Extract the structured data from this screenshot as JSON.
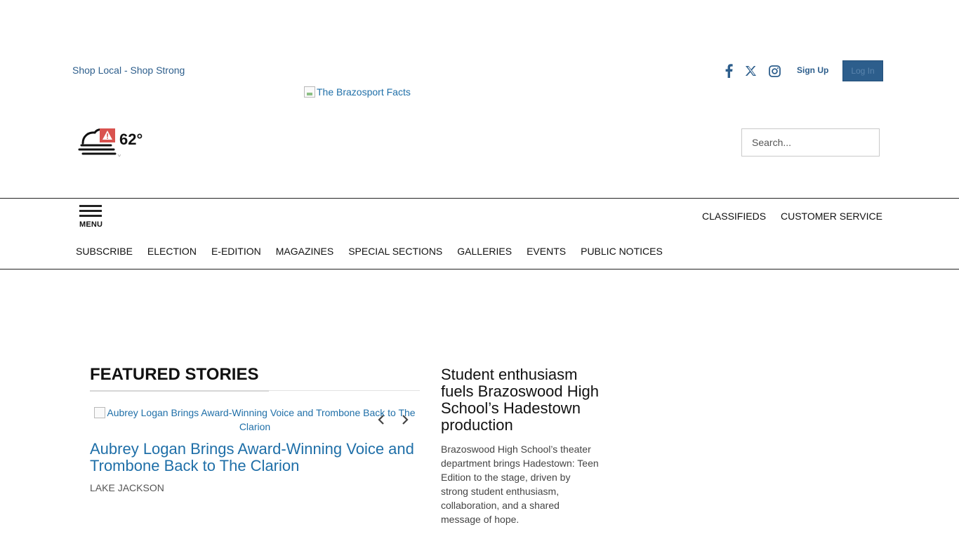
{
  "header": {
    "promo_link": "Shop Local - Shop Strong",
    "social": [
      "facebook-icon",
      "x-icon",
      "instagram-icon"
    ],
    "signup_label": "Sign Up",
    "login_label": "Log In",
    "logo_alt": "The Brazosport Facts",
    "accent_color": "#2d5e8c"
  },
  "weather": {
    "icon": "cloud-fog-alert-icon",
    "temperature": "62°"
  },
  "search": {
    "placeholder": "Search..."
  },
  "nav": {
    "menu_label": "MENU",
    "right_links": [
      "CLASSIFIEDS",
      "CUSTOMER SERVICE"
    ],
    "main_links": [
      "SUBSCRIBE",
      "ELECTION",
      "E-EDITION",
      "MAGAZINES",
      "SPECIAL SECTIONS",
      "GALLERIES",
      "EVENTS",
      "PUBLIC NOTICES"
    ]
  },
  "featured": {
    "section_title": "FEATURED STORIES",
    "image_alt": "Aubrey Logan Brings Award-Winning Voice and Trombone Back to The Clarion",
    "headline": "Aubrey Logan Brings Award-Winning Voice and Trombone Back to The Clarion",
    "kicker": "LAKE JACKSON"
  },
  "side_story": {
    "headline": "Student enthusiasm fuels Brazoswood High School’s Hadestown production",
    "summary": "Brazoswood High School’s theater department brings Hadestown: Teen Edition to the stage, driven by strong student enthusiasm, collaboration, and a shared message of hope."
  }
}
